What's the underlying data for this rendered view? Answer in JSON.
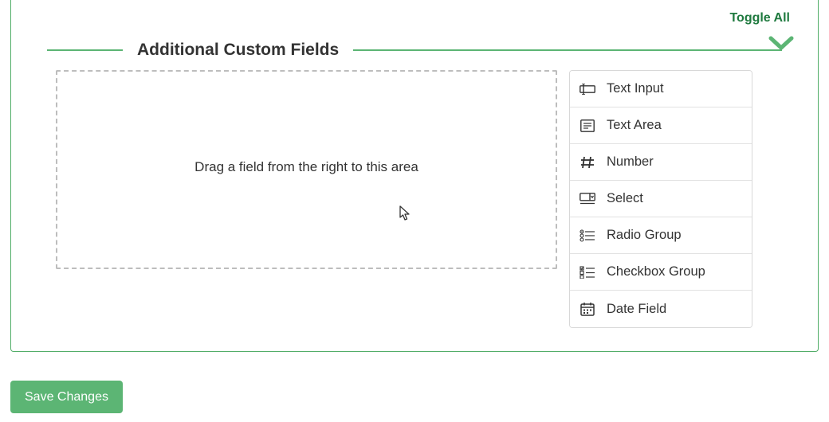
{
  "toggle_all_label": "Toggle All",
  "section_title": "Additional Custom Fields",
  "drop_zone_text": "Drag a field from the right to this area",
  "field_palette": [
    {
      "id": "text-input",
      "label": "Text Input",
      "icon": "text-input-icon"
    },
    {
      "id": "text-area",
      "label": "Text Area",
      "icon": "text-area-icon"
    },
    {
      "id": "number",
      "label": "Number",
      "icon": "number-icon"
    },
    {
      "id": "select",
      "label": "Select",
      "icon": "select-icon"
    },
    {
      "id": "radio-group",
      "label": "Radio Group",
      "icon": "radio-group-icon"
    },
    {
      "id": "checkbox-group",
      "label": "Checkbox Group",
      "icon": "checkbox-group-icon"
    },
    {
      "id": "date-field",
      "label": "Date Field",
      "icon": "date-field-icon"
    }
  ],
  "save_button_label": "Save Changes",
  "colors": {
    "accent": "#5cb574",
    "accent_dark": "#1f7a3f",
    "text": "#333333",
    "border_dash": "#bdbdbd",
    "border_light": "#d8d8d8"
  }
}
